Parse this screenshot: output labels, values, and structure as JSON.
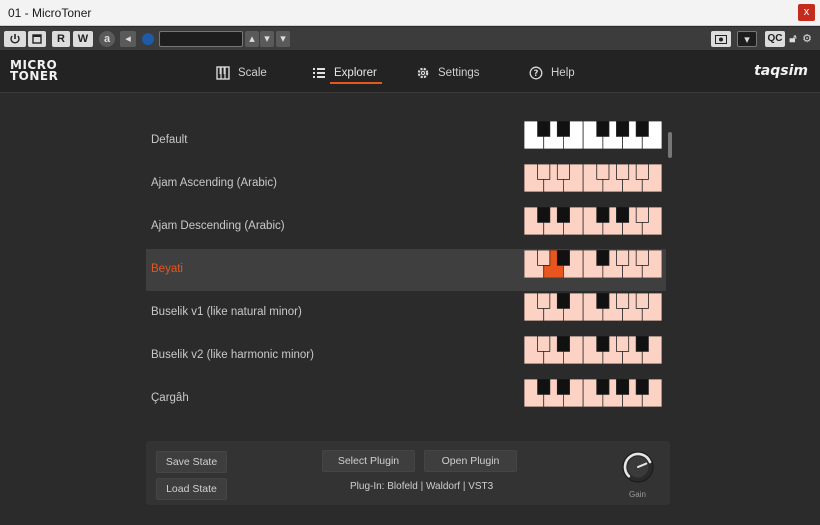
{
  "window": {
    "title": "01 - MicroToner",
    "close_label": "x"
  },
  "hostbar": {
    "buttons": [
      "R",
      "W",
      "a"
    ],
    "right_label": "QC"
  },
  "header": {
    "logo_line1": "MICRO",
    "logo_line2": "TONER",
    "brand": "taqsim",
    "tabs": [
      {
        "label": "Scale",
        "icon": "piano-icon"
      },
      {
        "label": "Explorer",
        "icon": "list-icon",
        "active": true
      },
      {
        "label": "Settings",
        "icon": "gear-icon"
      },
      {
        "label": "Help",
        "icon": "help-icon"
      }
    ],
    "accent": "#e8551e"
  },
  "scales": [
    {
      "name": "Default",
      "marks": [],
      "selected": false
    },
    {
      "name": "Ajam Ascending (Arabic)",
      "marks": [
        "w1",
        "b1",
        "w2",
        "b2",
        "w3",
        "w4",
        "b3",
        "w5",
        "b4",
        "w6",
        "b5",
        "w7"
      ],
      "selected": false
    },
    {
      "name": "Ajam Descending (Arabic)",
      "marks": [
        "w1",
        "w2",
        "w3",
        "w4",
        "w5",
        "w6",
        "b5",
        "w7"
      ],
      "selected": false
    },
    {
      "name": "Beyati",
      "marks": [
        "w1",
        "b1",
        "w2",
        "w3",
        "w4",
        "w5",
        "b4",
        "w6",
        "b5",
        "w7"
      ],
      "highlight": "w2",
      "selected": true
    },
    {
      "name": "Buselik v1 (like natural minor)",
      "marks": [
        "w1",
        "b1",
        "w2",
        "w3",
        "w4",
        "w5",
        "b4",
        "w6",
        "b5",
        "w7"
      ],
      "selected": false
    },
    {
      "name": "Buselik v2 (like harmonic minor)",
      "marks": [
        "w1",
        "b1",
        "w2",
        "w3",
        "w4",
        "w5",
        "b4",
        "w6",
        "w7"
      ],
      "selected": false
    },
    {
      "name": "Çargâh",
      "marks": [
        "w1",
        "w2",
        "w3",
        "w4",
        "w5",
        "w6",
        "w7"
      ],
      "selected": false
    }
  ],
  "bottom": {
    "save_state": "Save State",
    "load_state": "Load State",
    "select_plugin": "Select Plugin",
    "open_plugin": "Open Plugin",
    "plugin_info": "Plug-In: Blofeld | Waldorf | VST3",
    "gain_label": "Gain",
    "gain_value": 0.75
  }
}
